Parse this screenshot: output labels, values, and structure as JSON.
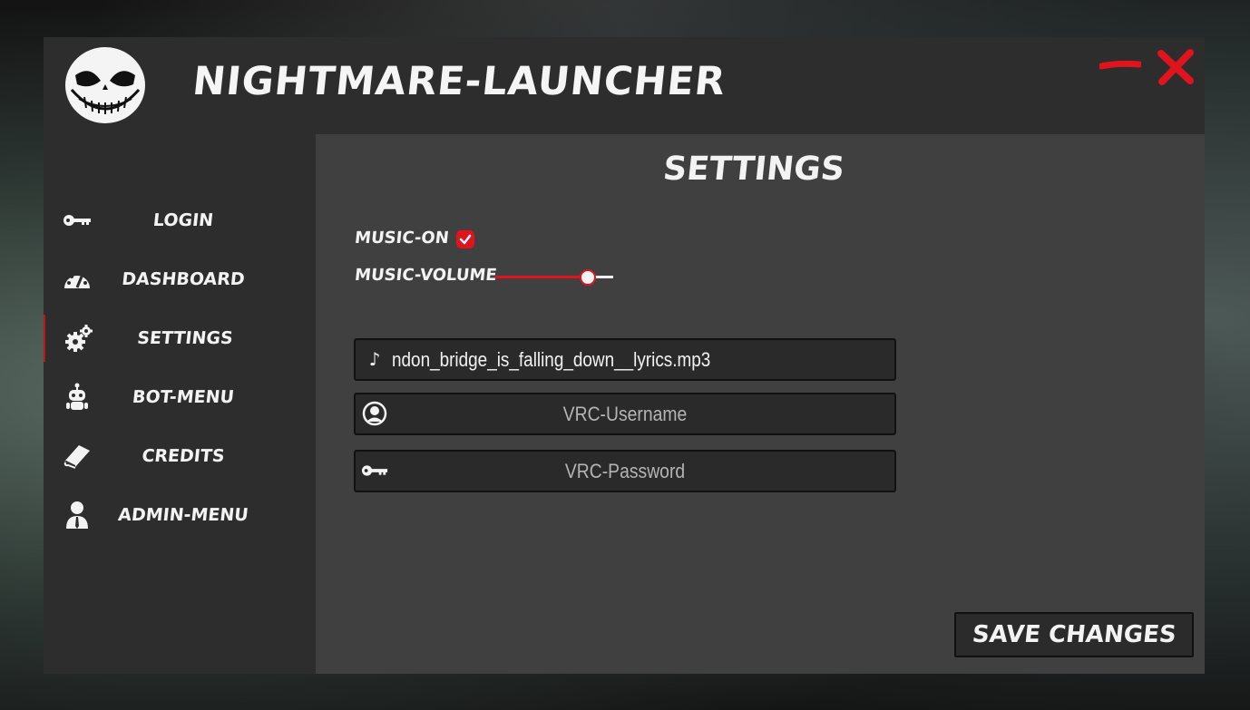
{
  "app": {
    "title": "NIGHTMARE-LAUNCHER"
  },
  "sidebar": {
    "items": [
      {
        "label": "LOGIN",
        "icon": "key-icon"
      },
      {
        "label": "DASHBOARD",
        "icon": "gauge-icon"
      },
      {
        "label": "SETTINGS",
        "icon": "gears-icon",
        "active": true
      },
      {
        "label": "BOT-MENU",
        "icon": "robot-icon"
      },
      {
        "label": "CREDITS",
        "icon": "book-icon"
      },
      {
        "label": "ADMIN-MENU",
        "icon": "user-tie-icon"
      }
    ]
  },
  "settings": {
    "title": "SETTINGS",
    "music_on_label": "MUSIC-ON",
    "music_on_checked": true,
    "music_volume_label": "MUSIC-VOLUME",
    "music_volume": 0.77,
    "music_file": "ndon_bridge_is_falling_down__lyrics.mp3",
    "username_placeholder": "VRC-Username",
    "password_placeholder": "VRC-Password",
    "save_label": "SAVE CHANGES"
  },
  "colors": {
    "accent": "#e0141c",
    "panel": "#404040",
    "window": "#2d2d2d"
  }
}
